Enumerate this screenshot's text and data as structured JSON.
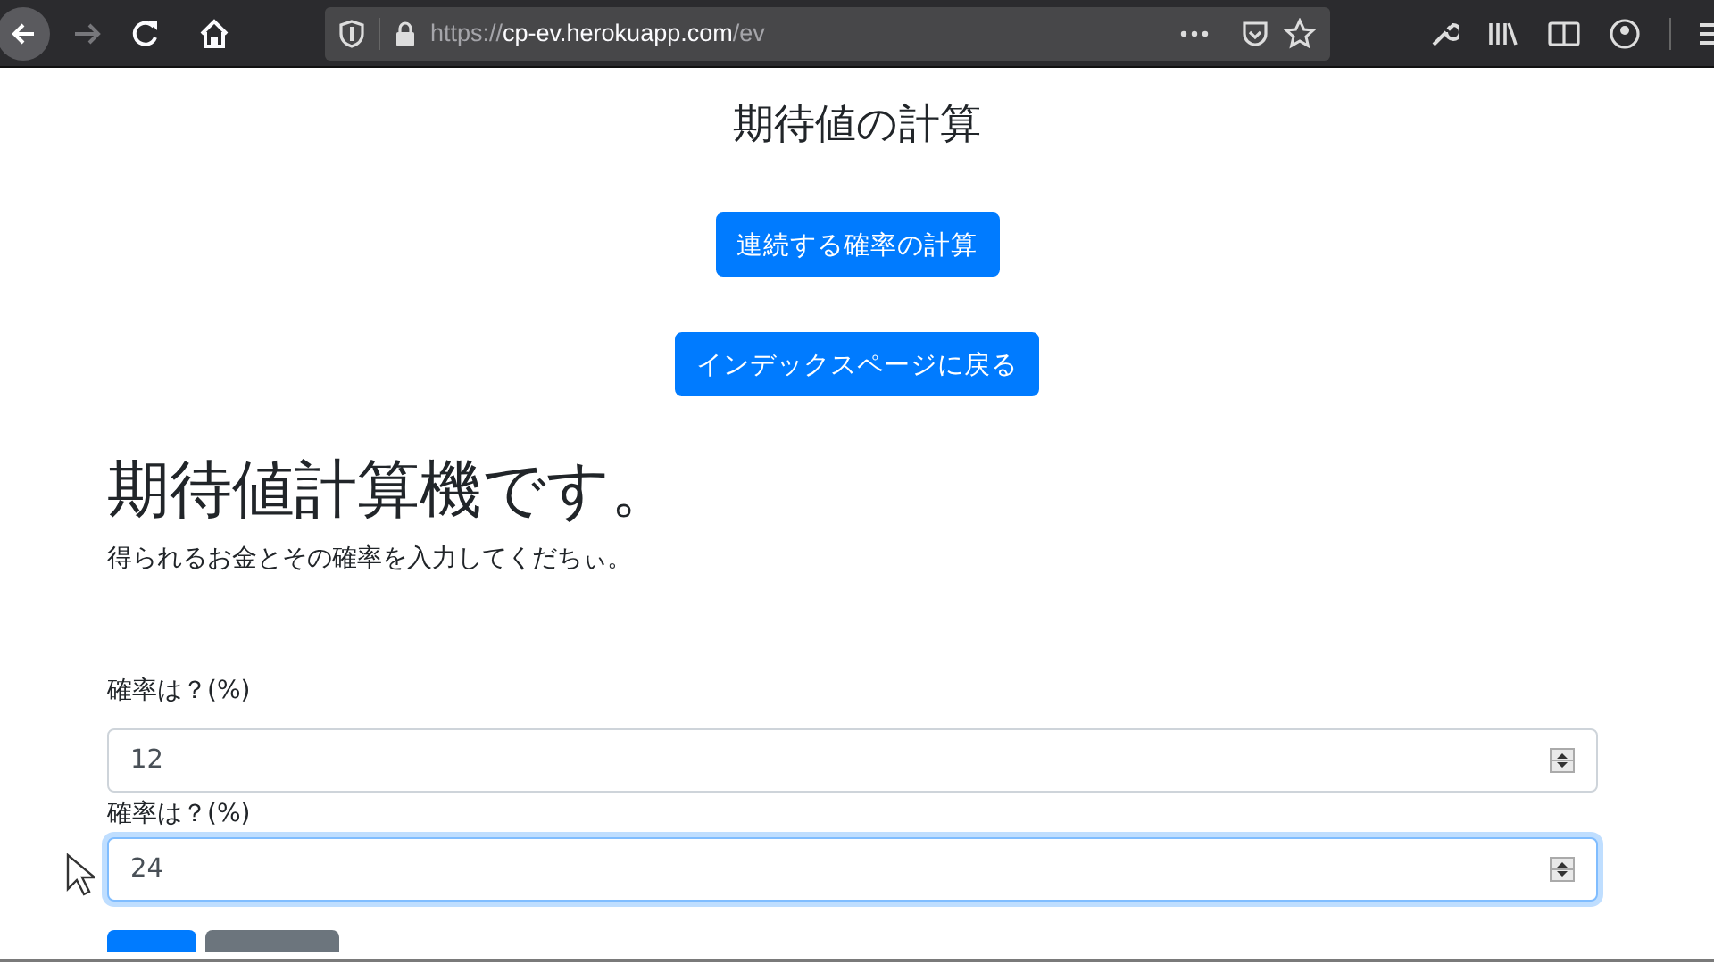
{
  "browser": {
    "url_scheme": "https://",
    "url_host": "cp-ev.herokuapp.com",
    "url_path": "/ev",
    "forward_disabled": true
  },
  "page": {
    "title": "期待値の計算",
    "nav_buttons": [
      "連続する確率の計算",
      "インデックスページに戻る"
    ],
    "heading": "期待値計算機です。",
    "description": "得られるお金とその確率を入力してくだちぃ。",
    "fields": [
      {
        "label": "確率は？(%)",
        "value": "12",
        "focused": false
      },
      {
        "label": "確率は？(%)",
        "value": "24",
        "focused": true
      }
    ],
    "buttons": [
      {
        "kind": "primary"
      },
      {
        "kind": "secondary"
      }
    ]
  }
}
